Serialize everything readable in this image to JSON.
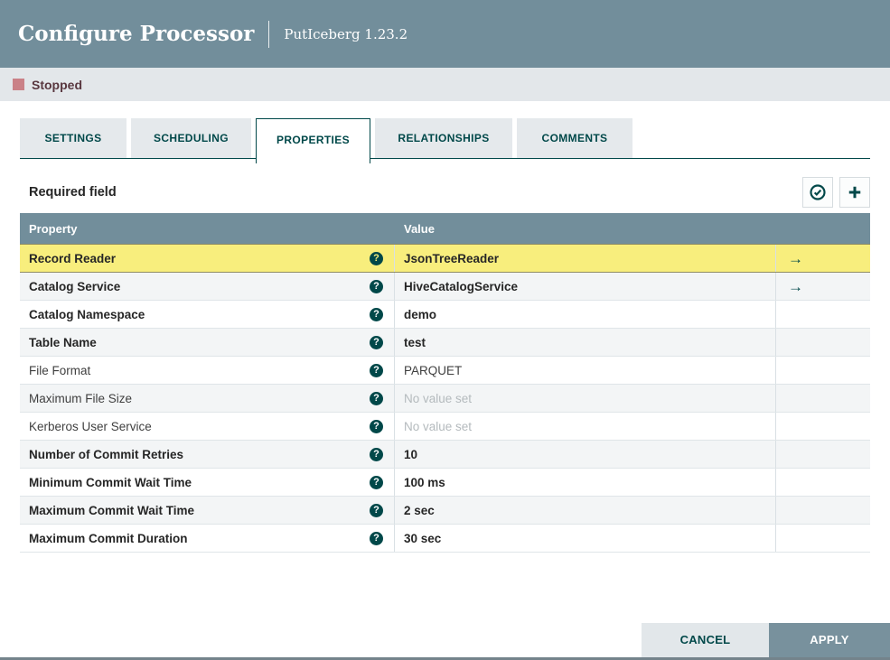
{
  "window": {
    "title": "Configure Processor",
    "subtitle": "PutIceberg 1.23.2"
  },
  "status": {
    "label": "Stopped",
    "color": "#ca8187"
  },
  "tabs": [
    {
      "label": "SETTINGS",
      "active": false
    },
    {
      "label": "SCHEDULING",
      "active": false
    },
    {
      "label": "PROPERTIES",
      "active": true
    },
    {
      "label": "RELATIONSHIPS",
      "active": false
    },
    {
      "label": "COMMENTS",
      "active": false
    }
  ],
  "properties_panel": {
    "required_label": "Required field",
    "verify_button_icon": "check-circle",
    "add_button_icon": "plus"
  },
  "table": {
    "columns": [
      "Property",
      "Value"
    ],
    "empty_value_text": "No value set",
    "help_icon": "?",
    "goto_icon": "→",
    "rows": [
      {
        "property": "Record Reader",
        "value": "JsonTreeReader",
        "required": true,
        "selected": true,
        "goto": true
      },
      {
        "property": "Catalog Service",
        "value": "HiveCatalogService",
        "required": true,
        "selected": false,
        "goto": true
      },
      {
        "property": "Catalog Namespace",
        "value": "demo",
        "required": true,
        "selected": false,
        "goto": false
      },
      {
        "property": "Table Name",
        "value": "test",
        "required": true,
        "selected": false,
        "goto": false
      },
      {
        "property": "File Format",
        "value": "PARQUET",
        "required": false,
        "selected": false,
        "goto": false
      },
      {
        "property": "Maximum File Size",
        "value": null,
        "required": false,
        "selected": false,
        "goto": false
      },
      {
        "property": "Kerberos User Service",
        "value": null,
        "required": false,
        "selected": false,
        "goto": false
      },
      {
        "property": "Number of Commit Retries",
        "value": "10",
        "required": true,
        "selected": false,
        "goto": false
      },
      {
        "property": "Minimum Commit Wait Time",
        "value": "100 ms",
        "required": true,
        "selected": false,
        "goto": false
      },
      {
        "property": "Maximum Commit Wait Time",
        "value": "2 sec",
        "required": true,
        "selected": false,
        "goto": false
      },
      {
        "property": "Maximum Commit Duration",
        "value": "30 sec",
        "required": true,
        "selected": false,
        "goto": false
      }
    ]
  },
  "footer": {
    "cancel_label": "CANCEL",
    "apply_label": "APPLY"
  },
  "colors": {
    "accent_teal": "#004849",
    "header_slate": "#728e9b",
    "selected_row_yellow": "#f8ee7d",
    "stopped_red": "#ca8187",
    "alt_row": "#f3f5f6"
  }
}
